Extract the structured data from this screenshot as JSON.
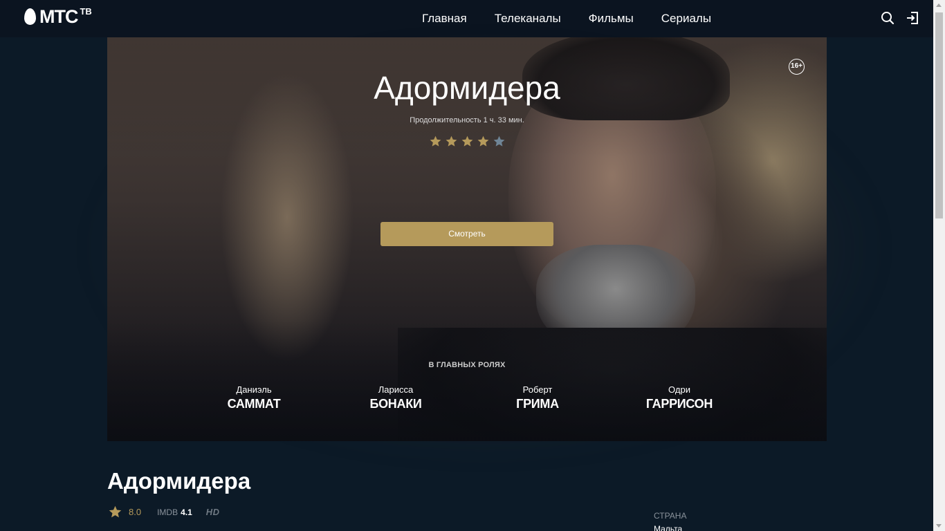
{
  "header": {
    "logo_text": "МТС",
    "logo_sup": "ТВ",
    "nav": [
      "Главная",
      "Телеканалы",
      "Фильмы",
      "Сериалы"
    ],
    "icons": [
      "search-icon",
      "login-icon"
    ]
  },
  "hero": {
    "age_rating": "16+",
    "title": "Адормидера",
    "duration": "Продолжительность 1 ч. 33 мин.",
    "stars_filled": 4,
    "stars_total": 5,
    "watch_label": "Смотреть",
    "cast_heading": "В ГЛАВНЫХ РОЛЯХ",
    "cast": [
      {
        "first": "Даниэль",
        "last": "САММАТ"
      },
      {
        "first": "Ларисса",
        "last": "БОНАКИ"
      },
      {
        "first": "Роберт",
        "last": "ГРИМА"
      },
      {
        "first": "Одри",
        "last": "ГАРРИСОН"
      }
    ]
  },
  "info": {
    "title": "Адормидера",
    "rating": "8.0",
    "imdb_label": "IMDB",
    "imdb_value": "4.1",
    "quality": "HD",
    "country_label": "СТРАНА",
    "country_value": "Мальта"
  },
  "colors": {
    "background": "#0c1a27",
    "header": "#0b1420",
    "accent_gold": "#b59a5b",
    "star_empty": "#6f8596"
  }
}
